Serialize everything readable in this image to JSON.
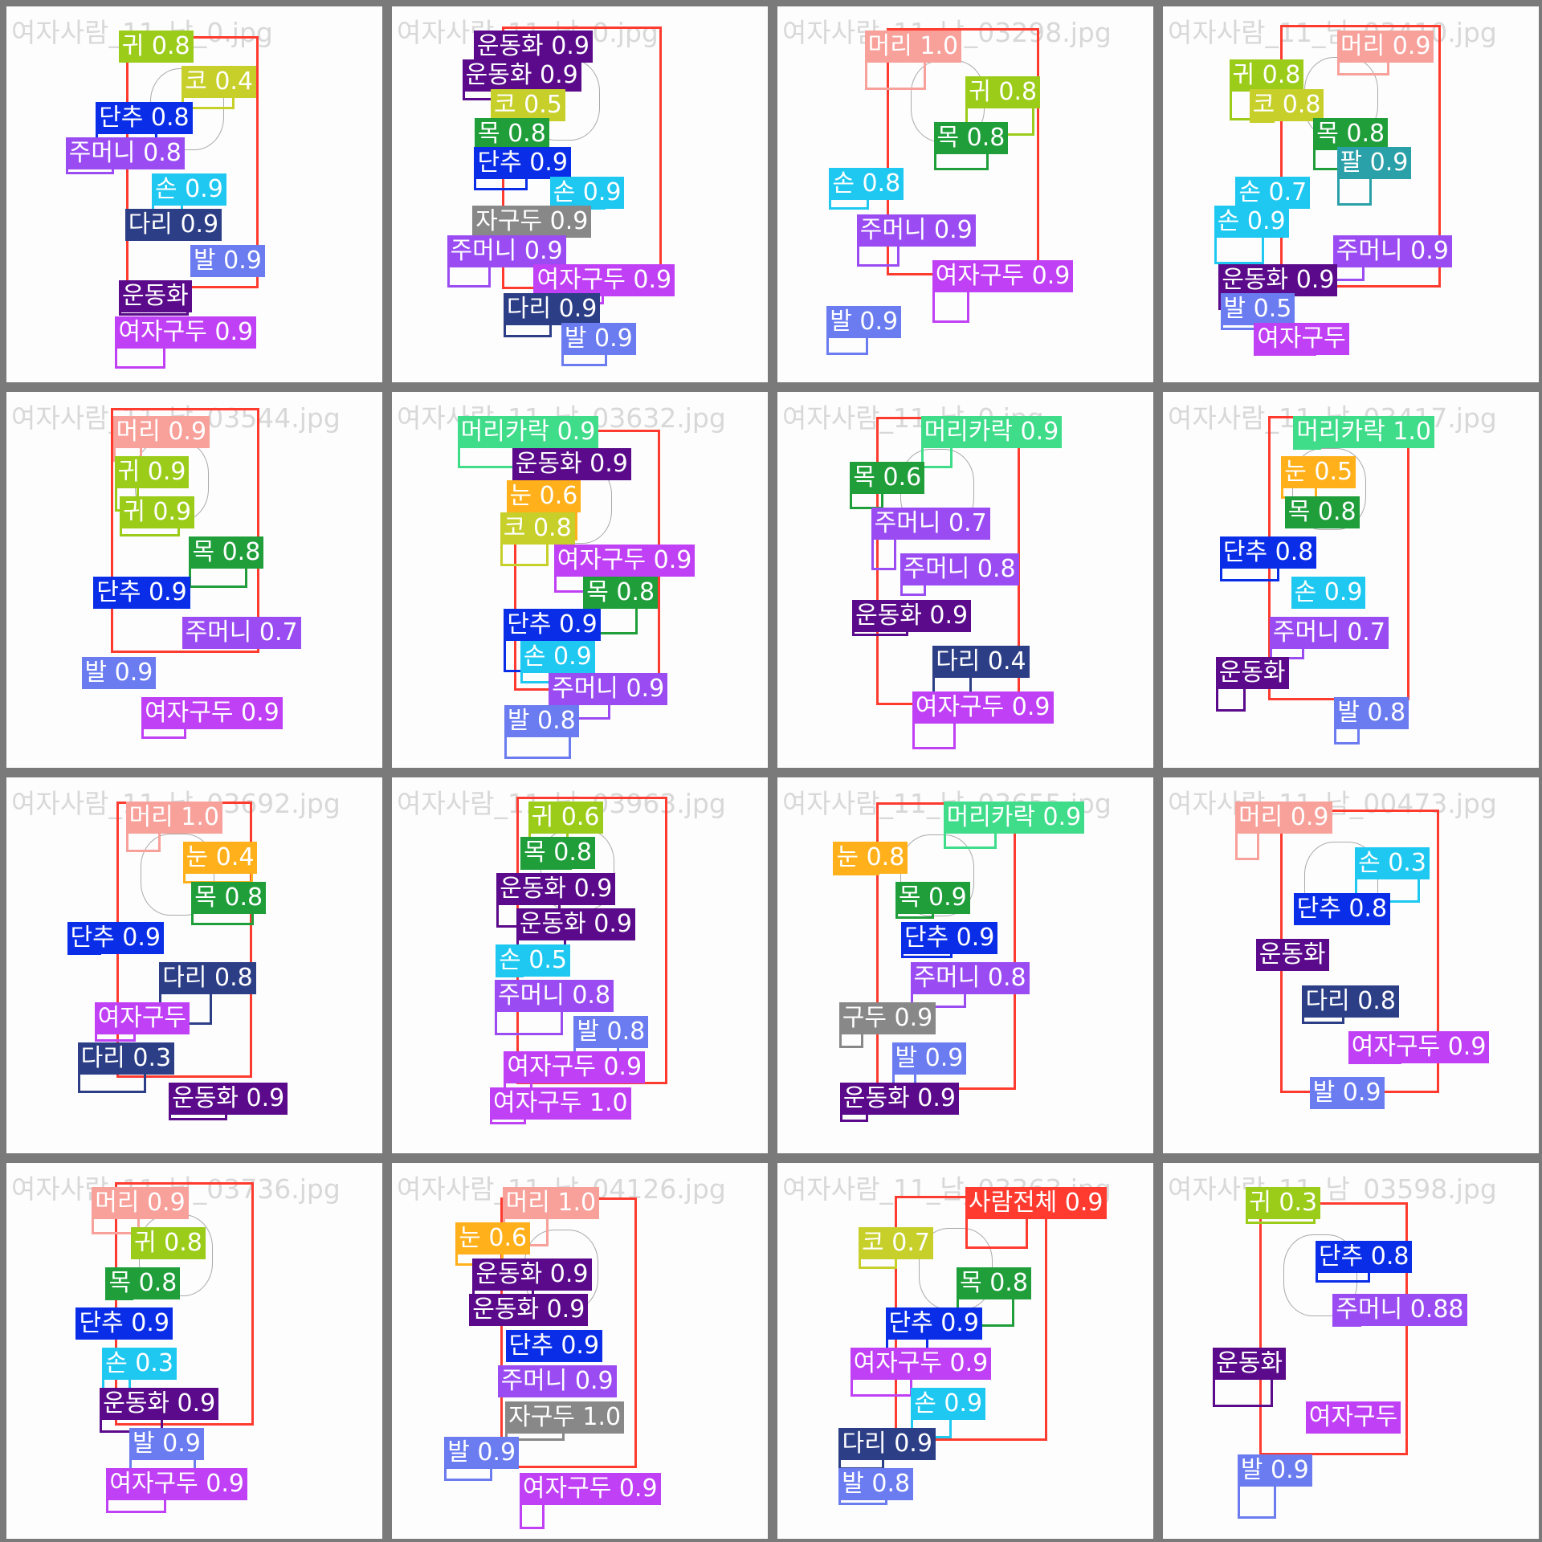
{
  "tiles": [
    {
      "file": "여자사람_11_남_0.jpg",
      "labels": [
        "귀 0.8",
        "코 0.4",
        "단추 0.8",
        "주머니 0.8",
        "손 0.9",
        "다리 0.9",
        "발 0.9",
        "운동화",
        "여자구두 0.9"
      ]
    },
    {
      "file": "여자사람_11_남_0.jpg",
      "labels": [
        "운동화 0.9",
        "운동화 0.9",
        "코 0.5",
        "목 0.8",
        "단추 0.9",
        "손 0.9",
        "자구두 0.9",
        "주머니 0.9",
        "여자구두 0.9",
        "다리 0.9",
        "발 0.9"
      ]
    },
    {
      "file": "여자사람_11_남_03298.jpg",
      "labels": [
        "머리 1.0",
        "귀 0.8",
        "목 0.8",
        "손 0.8",
        "주머니 0.9",
        "여자구두 0.9",
        "발 0.9"
      ]
    },
    {
      "file": "여자사람_11_남_03410.jpg",
      "labels": [
        "머리 0.9",
        "귀 0.8",
        "코 0.8",
        "목 0.8",
        "팔 0.9",
        "손 0.7",
        "손 0.9",
        "주머니 0.9",
        "운동화 0.9",
        "발 0.5",
        "여자구두"
      ]
    },
    {
      "file": "여자사람_11_남_03544.jpg",
      "labels": [
        "머리 0.9",
        "귀 0.9",
        "귀 0.9",
        "목 0.8",
        "단추 0.9",
        "주머니 0.7",
        "발 0.9",
        "여자구두 0.9"
      ]
    },
    {
      "file": "여자사람_11_남_03632.jpg",
      "labels": [
        "머리카락 0.9",
        "운동화 0.9",
        "눈 0.6",
        "코 0.8",
        "여자구두 0.9",
        "목 0.8",
        "단추 0.9",
        "손 0.9",
        "주머니 0.9",
        "발 0.8"
      ]
    },
    {
      "file": "여자사람_11_남_0.jpg",
      "labels": [
        "머리카락 0.9",
        "목 0.6",
        "주머니 0.7",
        "주머니 0.8",
        "운동화 0.9",
        "다리 0.4",
        "여자구두 0.9"
      ]
    },
    {
      "file": "여자사람_11_남_03417.jpg",
      "labels": [
        "머리카락 1.0",
        "눈 0.5",
        "목 0.8",
        "단추 0.8",
        "손 0.9",
        "주머니 0.7",
        "운동화",
        "발 0.8"
      ]
    },
    {
      "file": "여자사람_11_남_03692.jpg",
      "labels": [
        "머리 1.0",
        "눈 0.4",
        "목 0.8",
        "단추 0.9",
        "다리 0.8",
        "여자구두",
        "다리 0.3",
        "운동화 0.9"
      ]
    },
    {
      "file": "여자사람_11_남_03963.jpg",
      "labels": [
        "귀 0.6",
        "목 0.8",
        "운동화 0.9",
        "운동화 0.9",
        "손 0.5",
        "주머니 0.8",
        "발 0.8",
        "여자구두 0.9",
        "여자구두 1.0"
      ]
    },
    {
      "file": "여자사람_11_남_03655.jpg",
      "labels": [
        "머리카락 0.9",
        "눈 0.8",
        "목 0.9",
        "단추 0.9",
        "주머니 0.8",
        "구두 0.9",
        "발 0.9",
        "운동화 0.9"
      ]
    },
    {
      "file": "여자사람_11_남_00473.jpg",
      "labels": [
        "머리 0.9",
        "손 0.3",
        "단추 0.8",
        "운동화",
        "다리 0.8",
        "여자구두 0.9",
        "발 0.9"
      ]
    },
    {
      "file": "여자사람_11_남_03736.jpg",
      "labels": [
        "머리 0.9",
        "귀 0.8",
        "목 0.8",
        "단추 0.9",
        "손 0.3",
        "운동화 0.9",
        "발 0.9",
        "여자구두 0.9"
      ]
    },
    {
      "file": "여자사람_11_남_04126.jpg",
      "labels": [
        "머리 1.0",
        "눈 0.6",
        "운동화 0.9",
        "운동화 0.9",
        "단추 0.9",
        "주머니 0.9",
        "자구두 1.0",
        "발 0.9",
        "여자구두 0.9"
      ]
    },
    {
      "file": "여자사람_11_남_03363.jpg",
      "labels": [
        "사람전체 0.9",
        "코 0.7",
        "목 0.8",
        "단추 0.9",
        "여자구두 0.9",
        "손 0.9",
        "다리 0.9",
        "발 0.8"
      ]
    },
    {
      "file": "여자사람_11_남_03598.jpg",
      "labels": [
        "귀 0.3",
        "단추 0.8",
        "주머니 0.88",
        "운동화",
        "여자구두",
        "발 0.9"
      ]
    }
  ],
  "colors": {
    "사람": "#ff3b30",
    "머리": "#f8a09a",
    "머리카락": "#3fdc8a",
    "귀": "#9ccc1a",
    "눈": "#ffb01a",
    "코": "#c7cf2a",
    "입": "#5fe81a",
    "목": "#1f9e3a",
    "팔": "#2aa0a8",
    "손": "#1ec8f0",
    "단추": "#0a2ee8",
    "주머니": "#9a4cf2",
    "다리": "#2c3e86",
    "발": "#6a7cf0",
    "운동화": "#5a0a8a",
    "여자구두": "#c040f5"
  }
}
